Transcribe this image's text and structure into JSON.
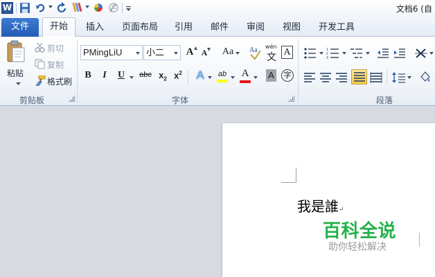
{
  "window": {
    "title": "文档6 (自"
  },
  "quick_access": {
    "app_icon": "word-app-icon",
    "app_letter": "W",
    "items": [
      "save-icon",
      "undo-icon",
      "redo-icon",
      "format-painter-icon",
      "color-theme-icon",
      "clear-format-icon",
      "customize-qat-icon"
    ]
  },
  "tabs": {
    "file": "文件",
    "items": [
      "开始",
      "插入",
      "页面布局",
      "引用",
      "邮件",
      "审阅",
      "视图",
      "开发工具"
    ],
    "active": "开始"
  },
  "clipboard": {
    "paste_label": "粘贴",
    "cut_label": "剪切",
    "copy_label": "复制",
    "format_painter_label": "格式刷",
    "group_label": "剪贴板"
  },
  "font": {
    "font_name": "PMingLiU",
    "font_size": "小二",
    "grow_label": "A",
    "shrink_label": "A",
    "case_label": "Aa",
    "phonetic_label": "wén",
    "phonetic_char": "文",
    "border_label": "A",
    "bold": "B",
    "italic": "I",
    "underline": "U",
    "strike": "abc",
    "subscript": "x",
    "subscript_sub": "2",
    "superscript": "x",
    "superscript_sup": "2",
    "text_effect": "A",
    "highlight_label": "ab",
    "font_color_label": "A",
    "char_shading_label": "A",
    "enclose_label": "字",
    "group_label": "字体",
    "colors": {
      "highlight": "#ffff00",
      "font_color": "#e01818"
    }
  },
  "paragraph": {
    "group_label": "段落",
    "active_alignment": "justify"
  },
  "document": {
    "text": "我是誰",
    "watermark_title": "百科全说",
    "watermark_subtitle": "助你轻松解决"
  }
}
